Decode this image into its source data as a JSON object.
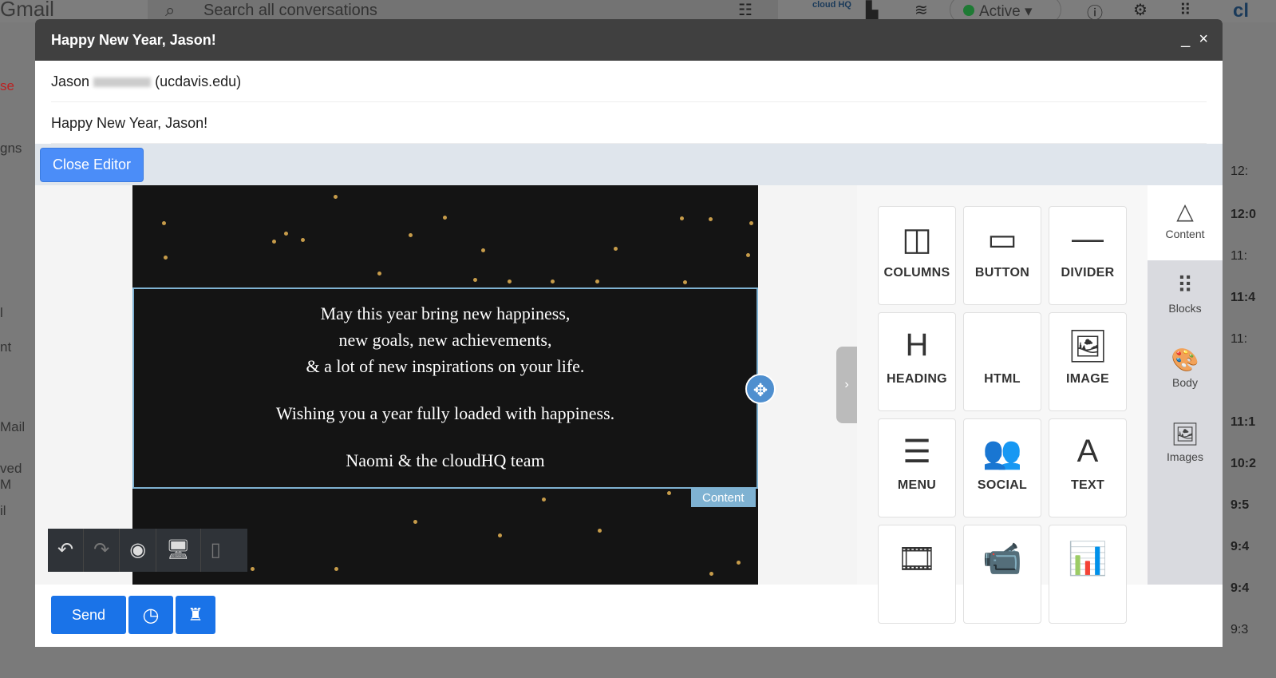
{
  "gmail": {
    "logo": "Gmail",
    "search_placeholder": "Search all conversations",
    "status": "Active",
    "cloudhq": "cloud HQ",
    "right_brand": "cl",
    "left_fragments": [
      "se",
      "gns",
      "l",
      "nt",
      "Mail",
      "ved M",
      "il"
    ],
    "times": [
      "12:",
      "12:0",
      "11:",
      "11:4",
      "11:",
      "11:1",
      "10:2",
      "9:5",
      "9:4",
      "9:4",
      "9:3"
    ]
  },
  "compose": {
    "title": "Happy New Year, Jason!",
    "to_first": "Jason",
    "to_domain": "(ucdavis.edu)",
    "subject": "Happy New Year, Jason!",
    "close_editor": "Close Editor",
    "minimize": "_",
    "close": "×"
  },
  "email": {
    "lines": [
      "May this year bring new happiness,",
      "new goals, new achievements,",
      "& a lot of new inspirations on your life."
    ],
    "wish": "Wishing you a year fully loaded with happiness.",
    "signature": "Naomi & the cloudHQ team",
    "tag": "Content"
  },
  "blocks": [
    {
      "label": "COLUMNS",
      "icon": "columns-icon",
      "g": "◫"
    },
    {
      "label": "BUTTON",
      "icon": "button-icon",
      "g": "▭"
    },
    {
      "label": "DIVIDER",
      "icon": "divider-icon",
      "g": "—"
    },
    {
      "label": "HEADING",
      "icon": "heading-icon",
      "g": "H"
    },
    {
      "label": "HTML",
      "icon": "code-icon",
      "g": "</>"
    },
    {
      "label": "IMAGE",
      "icon": "image-icon",
      "g": "🖼"
    },
    {
      "label": "MENU",
      "icon": "menu-icon",
      "g": "☰"
    },
    {
      "label": "SOCIAL",
      "icon": "social-icon",
      "g": "👥"
    },
    {
      "label": "TEXT",
      "icon": "text-icon",
      "g": "A"
    },
    {
      "label": "",
      "icon": "film-icon",
      "g": "🎞"
    },
    {
      "label": "",
      "icon": "video-icon",
      "g": "📹"
    },
    {
      "label": "",
      "icon": "chart-icon",
      "g": "📊"
    }
  ],
  "tabs": [
    {
      "label": "Content",
      "g": "△"
    },
    {
      "label": "Blocks",
      "g": "⠿"
    },
    {
      "label": "Body",
      "g": "🎨"
    },
    {
      "label": "Images",
      "g": "🖼"
    }
  ],
  "footer": {
    "send": "Send"
  }
}
